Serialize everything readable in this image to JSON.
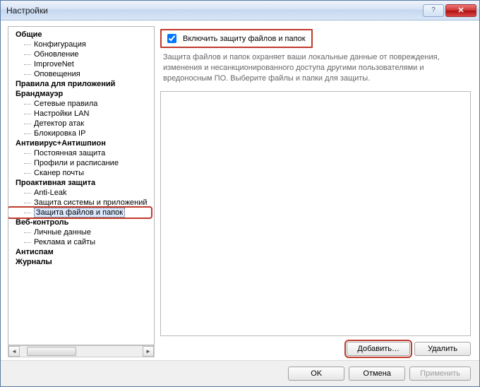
{
  "window": {
    "title": "Настройки"
  },
  "titlebar": {
    "help_label": "?",
    "close_label": "✕"
  },
  "sidebar": {
    "scroll_thumb_label": "",
    "groups": [
      {
        "label": "Общие",
        "children": [
          {
            "label": "Конфигурация"
          },
          {
            "label": "Обновление"
          },
          {
            "label": "ImproveNet"
          },
          {
            "label": "Оповещения"
          }
        ]
      },
      {
        "label": "Правила для приложений",
        "children": []
      },
      {
        "label": "Брандмауэр",
        "children": [
          {
            "label": "Сетевые правила"
          },
          {
            "label": "Настройки LAN"
          },
          {
            "label": "Детектор атак"
          },
          {
            "label": "Блокировка IP"
          }
        ]
      },
      {
        "label": "Антивирус+Антишпион",
        "children": [
          {
            "label": "Постоянная защита"
          },
          {
            "label": "Профили и расписание"
          },
          {
            "label": "Сканер почты"
          }
        ]
      },
      {
        "label": "Проактивная защита",
        "children": [
          {
            "label": "Anti-Leak"
          },
          {
            "label": "Защита системы и приложений"
          },
          {
            "label": "Защита файлов и папок",
            "selected": true,
            "highlighted": true
          }
        ]
      },
      {
        "label": "Веб-контроль",
        "children": [
          {
            "label": "Личные данные"
          },
          {
            "label": "Реклама и сайты"
          }
        ]
      },
      {
        "label": "Антиспам",
        "children": []
      },
      {
        "label": "Журналы",
        "children": []
      }
    ]
  },
  "main": {
    "enable_label": "Включить защиту файлов и папок",
    "description": "Защита файлов и папок охраняет ваши локальные данные от повреждения, изменения и несанкционированного доступа другими пользователями и вредоносным ПО. Выберите файлы и папки для защиты.",
    "add_label": "Добавить…",
    "delete_label": "Удалить"
  },
  "footer": {
    "ok": "OK",
    "cancel": "Отмена",
    "apply": "Применить"
  }
}
